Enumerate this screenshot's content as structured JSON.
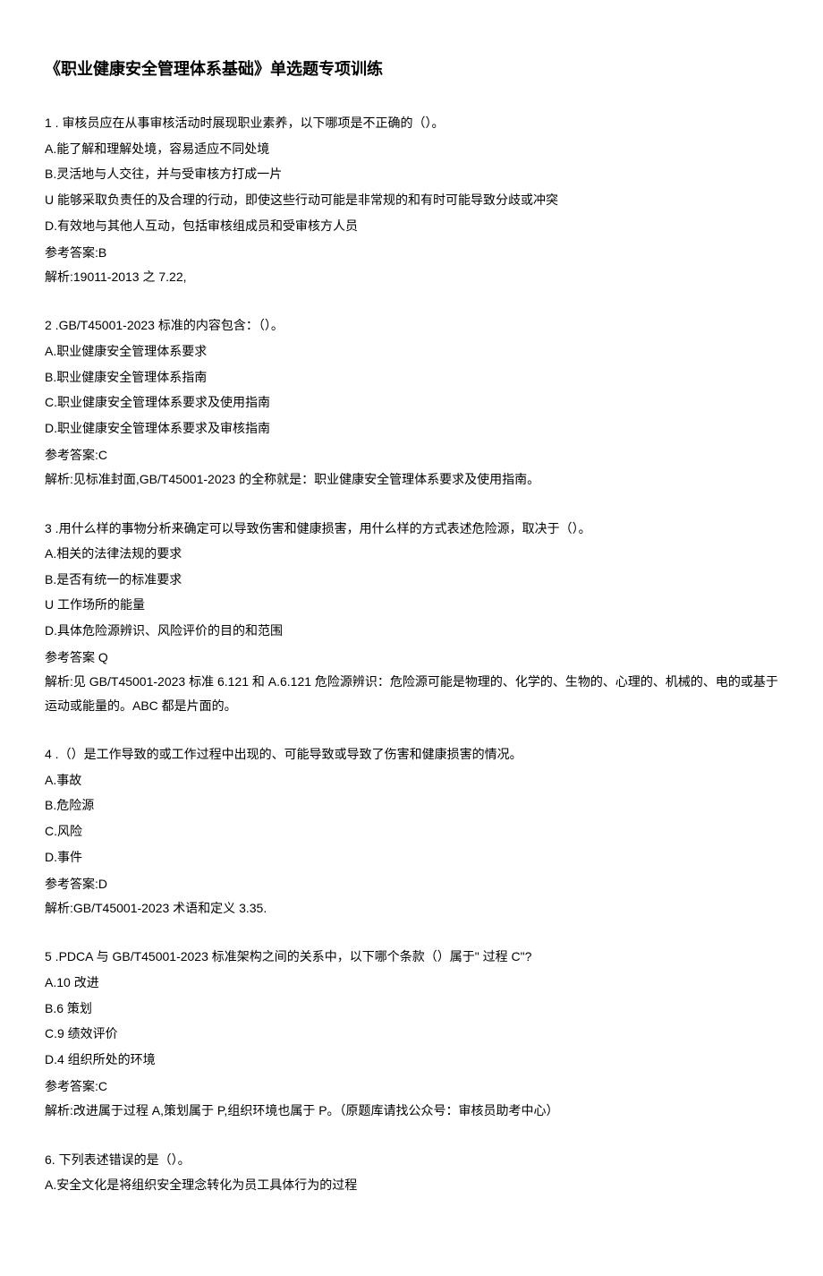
{
  "title": "《职业健康安全管理体系基础》单选题专项训练",
  "questions": [
    {
      "stem": "1 . 审核员应在从事审核活动时展现职业素养，以下哪项是不正确的（）。",
      "options": [
        "A.能了解和理解处境，容易适应不同处境",
        "B.灵活地与人交往，并与受审核方打成一片",
        "U 能够采取负责任的及合理的行动，即使这些行动可能是非常规的和有时可能导致分歧或冲突",
        "D.有效地与其他人互动，包括审核组成员和受审核方人员"
      ],
      "answer": "参考答案:B",
      "explain": "解析:19011-2013 之 7.22,"
    },
    {
      "stem": "2 .GB/T45001-2023 标准的内容包含：（）。",
      "options": [
        "A.职业健康安全管理体系要求",
        "B.职业健康安全管理体系指南",
        "C.职业健康安全管理体系要求及使用指南",
        "D.职业健康安全管理体系要求及审核指南"
      ],
      "answer": "参考答案:C",
      "explain": "解析:见标准封面,GB/T45001-2023 的全称就是：职业健康安全管理体系要求及使用指南。"
    },
    {
      "stem": "3 .用什么样的事物分析来确定可以导致伤害和健康损害，用什么样的方式表述危险源，取决于（）。",
      "options": [
        "A.相关的法律法规的要求",
        "B.是否有统一的标准要求",
        "U 工作场所的能量",
        "D.具体危险源辨识、风险评价的目的和范围"
      ],
      "answer": "参考答案 Q",
      "explain": "解析:见 GB/T45001-2023 标准 6.121 和 A.6.121 危险源辨识：危险源可能是物理的、化学的、生物的、心理的、机械的、电的或基于运动或能量的。ABC 都是片面的。"
    },
    {
      "stem": "4 .（）是工作导致的或工作过程中出现的、可能导致或导致了伤害和健康损害的情况。",
      "options": [
        "A.事故",
        "B.危险源",
        "C.风险",
        "D.事件"
      ],
      "answer": "参考答案:D",
      "explain": "解析:GB/T45001-2023 术语和定义 3.35."
    },
    {
      "stem": "5 .PDCA 与 GB/T45001-2023 标准架构之间的关系中，以下哪个条款（）属于\" 过程 C\"?",
      "options": [
        "A.10 改进",
        "B.6 策划",
        "C.9 绩效评价",
        "D.4 组织所处的环境"
      ],
      "answer": "参考答案:C",
      "explain": "解析:改进属于过程 A,策划属于 P,组织环境也属于 P。（原题库请找公众号：审核员助考中心）"
    },
    {
      "stem": "6. 下列表述错误的是（）。",
      "options": [
        "A.安全文化是将组织安全理念转化为员工具体行为的过程"
      ],
      "answer": "",
      "explain": ""
    }
  ]
}
